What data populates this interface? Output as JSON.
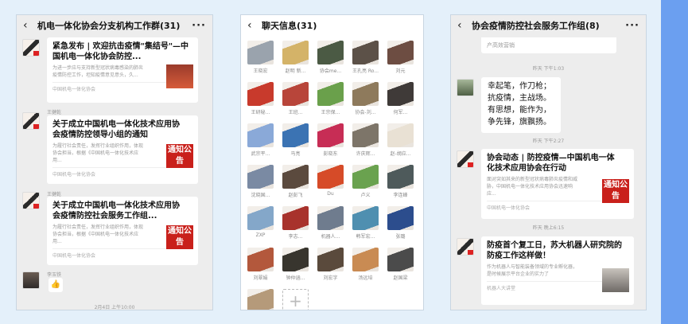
{
  "panel1": {
    "title": "机电一体化协会分支机构工作群(31)",
    "messages": [
      {
        "sender": "",
        "title": "紧急发布 | 欢迎抗击疫情\"集结号\"—中国机电一体化协会防控...",
        "desc": "为进一步应与支持新型冠状病毒感染的肺炎疫情防控工作，坦知疫情意见意头，久...",
        "source": "中国机电一体化协会",
        "thumb": ""
      },
      {
        "sender": "王健乾",
        "title": "关于成立中国机电一体化技术应用协会疫情防控领导小组的通知",
        "desc": "为履行社会责任，发挥行业组织作用，体现协会担当，根据《中国机电一体化技术应用...",
        "source": "中国机电一体化协会",
        "thumb": "通知公告"
      },
      {
        "sender": "王健乾",
        "title": "关于成立中国机电一体化技术应用协会疫情防控社会服务工作组...",
        "desc": "为履行社会责任，发挥行业组织作用，体现协会担当，根据《中国机电一体化技术应用...",
        "source": "中国机电一体化协会",
        "thumb": "通知公告"
      }
    ],
    "last_sender": "李玉铁",
    "emoji": "👍",
    "timestamp": "2月4日 上午10:00"
  },
  "panel2": {
    "title": "聊天信息(31)",
    "members": [
      {
        "name": "王晓宏",
        "color": "#9aa3ad"
      },
      {
        "name": "赵明 新...",
        "color": "#d4b368"
      },
      {
        "name": "协会me...",
        "color": "#4b5a44"
      },
      {
        "name": "王孔亮 Ro...",
        "color": "#5c5148"
      },
      {
        "name": "刘元",
        "color": "#6d4d42"
      },
      {
        "name": "王研秘...",
        "color": "#c83a2c"
      },
      {
        "name": "王班...",
        "color": "#b8453a"
      },
      {
        "name": "王宗保...",
        "color": "#6aa04b"
      },
      {
        "name": "协会-刘...",
        "color": "#8e7a5c"
      },
      {
        "name": "何军...",
        "color": "#3f3a38"
      },
      {
        "name": "武宗平...",
        "color": "#8aa9d8"
      },
      {
        "name": "马亮",
        "color": "#3b73b3"
      },
      {
        "name": "彭晓东",
        "color": "#c72d55"
      },
      {
        "name": "许庆辉...",
        "color": "#7d7569"
      },
      {
        "name": "赵-胡应...",
        "color": "#e9e1d4"
      },
      {
        "name": "沈晓国...",
        "color": "#7a8aa3"
      },
      {
        "name": "赵彭飞",
        "color": "#5b4a3e"
      },
      {
        "name": "Du",
        "color": "#d64b28"
      },
      {
        "name": "卢义",
        "color": "#6aa24f"
      },
      {
        "name": "李连峰",
        "color": "#4e5a5b"
      },
      {
        "name": "ZXP",
        "color": "#84a7c9"
      },
      {
        "name": "李志...",
        "color": "#a8322c"
      },
      {
        "name": "机器人...",
        "color": "#6f7c8e"
      },
      {
        "name": "韩军宏...",
        "color": "#4f8fb0"
      },
      {
        "name": "张璐",
        "color": "#2c4d8d"
      },
      {
        "name": "刘翠娟",
        "color": "#b3583c"
      },
      {
        "name": "钟仲涵...",
        "color": "#38352e"
      },
      {
        "name": "刘宏字",
        "color": "#5a4a3c"
      },
      {
        "name": "汤远培",
        "color": "#c98b53"
      },
      {
        "name": "赵国梁",
        "color": "#4b4b4b"
      },
      {
        "name": "",
        "color": "#b59a7a"
      }
    ],
    "add_symbol": "+"
  },
  "panel3": {
    "title": "协会疫情防控社会服务工作组(8)",
    "top_text": "产高效营销",
    "ts1": "昨天 下午1:03",
    "poem": [
      "幸起笔，作刀枪；",
      "抗疫情，主战场。",
      "有思想，能作为，",
      "争先锋，旗飘扬。"
    ],
    "ts2": "昨天 下午2:27",
    "article1": {
      "title": "协会动态 | 防控疫情—中国机电一体化技术应用协会在行动",
      "desc": "面对突如其来的新型冠状病毒肺炎疫情和威胁，中国机电一体化技术应用协会迅速响应...",
      "source": "中国机电一体化协会",
      "thumb": "通知公告"
    },
    "ts3": "昨天 晚上6:15",
    "article2": {
      "title": "防疫首个复工日，苏大机器人研究院的防疫工作这样做！",
      "desc": "作为机器人与智能装备领域的专业孵化器，是时候展示平台企业的实力了",
      "source": "机器人大讲堂"
    }
  }
}
